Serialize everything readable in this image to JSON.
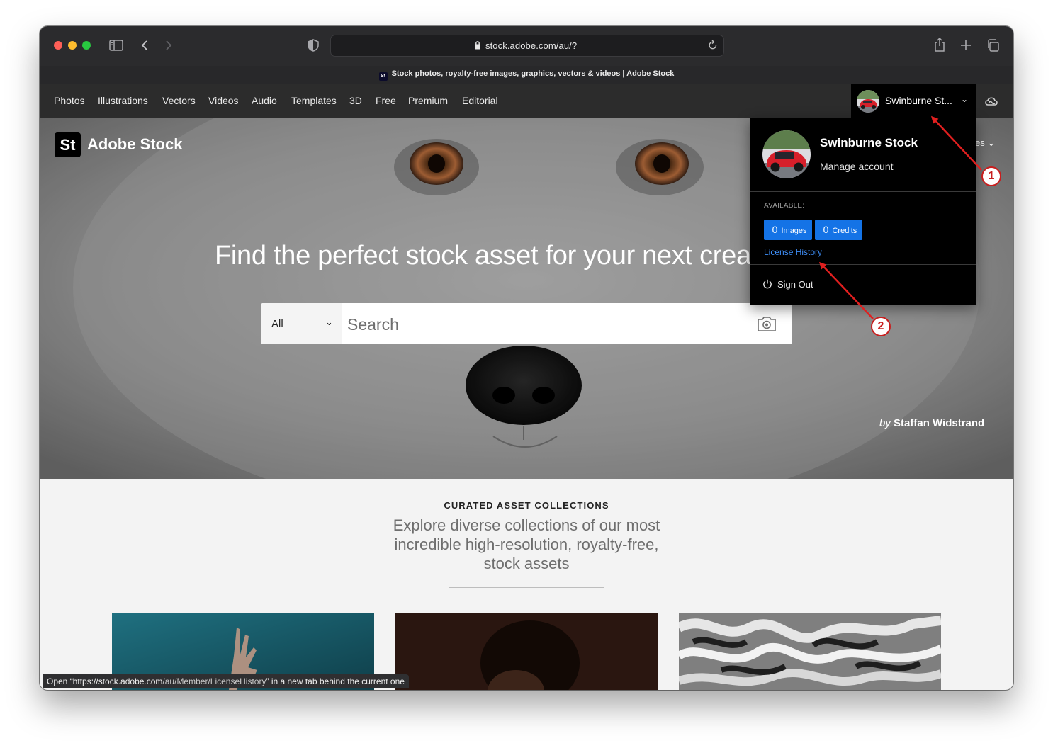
{
  "browser": {
    "url": "stock.adobe.com/au/?",
    "tab_title": "Stock photos, royalty-free images, graphics, vectors & videos | Adobe Stock",
    "favicon_text": "St",
    "icons": [
      "sidebar-icon",
      "back-icon",
      "forward-icon",
      "shield-icon",
      "lock-icon",
      "reload-icon",
      "share-icon",
      "new-tab-icon",
      "tabs-overview-icon"
    ]
  },
  "nav": {
    "links": [
      "Photos",
      "Illustrations",
      "Vectors",
      "Videos",
      "Audio",
      "Templates",
      "3D",
      "Free",
      "Premium",
      "Editorial"
    ],
    "account_name": "Swinburne St...",
    "hidden_menu_fragment": "es"
  },
  "hero": {
    "logo_mark": "St",
    "logo_text": "Adobe Stock",
    "headline": "Find the perfect stock asset for your next creative",
    "search": {
      "scope": "All",
      "placeholder": "Search"
    },
    "credit_prefix": "by",
    "credit_name": "Staffan Widstrand"
  },
  "curated": {
    "title": "CURATED ASSET COLLECTIONS",
    "description": "Explore diverse collections of our most incredible high-resolution, royalty-free, stock assets"
  },
  "account_menu": {
    "name": "Swinburne Stock",
    "manage_label": "Manage account",
    "available_label": "AVAILABLE:",
    "images_count": "0",
    "images_label": "Images",
    "credits_count": "0",
    "credits_label": "Credits",
    "license_history_label": "License History",
    "sign_out_label": "Sign Out"
  },
  "status_bar": {
    "prefix": "Open “https://stock.adobe.com",
    "path": "/au/Member/LicenseHistory",
    "suffix": "” in a new tab behind the current one"
  },
  "annotations": {
    "marker1": "1",
    "marker2": "2",
    "color": "#e01f1f"
  },
  "colors": {
    "accent": "#1473e6",
    "link": "#3e8ef7",
    "nav_bg": "#2c2c2c"
  }
}
